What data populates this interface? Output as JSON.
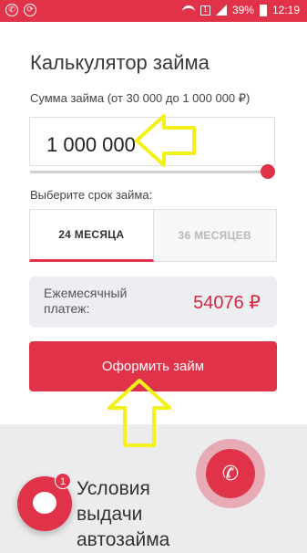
{
  "status_bar": {
    "battery": "39%",
    "time": "12:19",
    "sim_label": "1"
  },
  "calculator": {
    "title": "Калькулятор займа",
    "sum_label": "Сумма займа (от 30 000 до 1 000 000 ₽)",
    "sum_value": "1 000 000",
    "slider_level": 1.0,
    "term_label": "Выберите срок займа:",
    "tabs": [
      {
        "label": "24 МЕСЯЦА",
        "active": true
      },
      {
        "label": "36 МЕСЯЦЕВ",
        "active": false
      }
    ],
    "payment_label": "Ежемесячный платеж:",
    "payment_value": "54076 ₽",
    "submit_label": "Оформить займ"
  },
  "bottom": {
    "heading": "Условия выдачи автозайма",
    "chat_badge": "1"
  },
  "colors": {
    "accent": "#e0334a",
    "annotation_arrow": "#f4f11a"
  },
  "icons": [
    "whatsapp-icon",
    "sync-icon",
    "wifi-icon",
    "signal-icon",
    "battery-icon",
    "chat-icon",
    "phone-icon",
    "arrow-left-icon",
    "arrow-up-icon"
  ]
}
